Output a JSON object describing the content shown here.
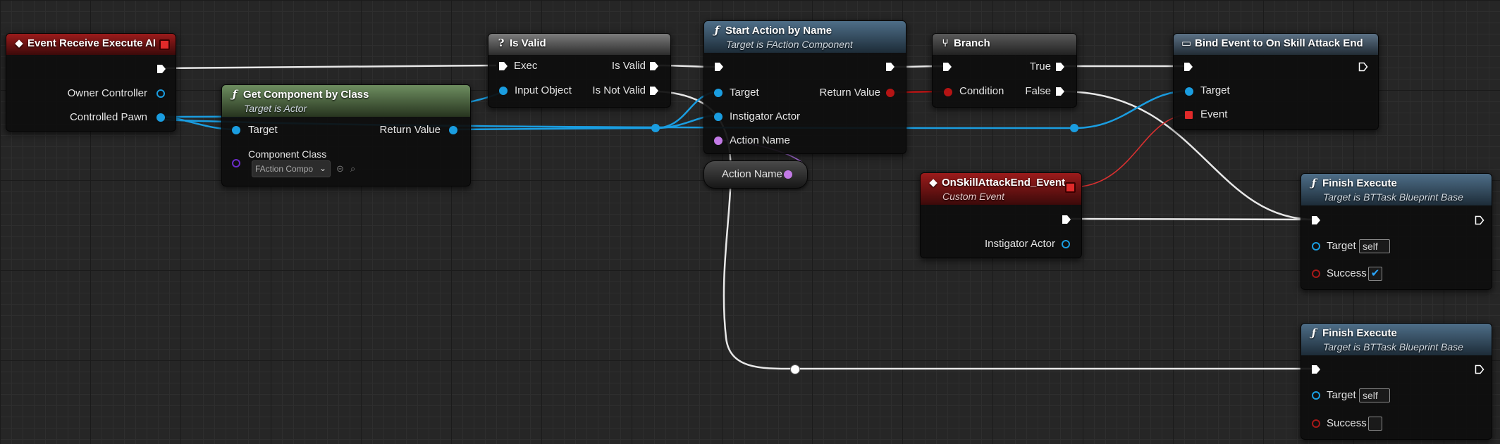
{
  "colors": {
    "exec": "#ffffff",
    "object": "#1a9de0",
    "name": "#c37ae6",
    "bool": "#b51414",
    "delegate": "#e02a2a"
  },
  "nodes": {
    "event_receive": {
      "title": "Event Receive Execute AI",
      "pins": {
        "owner": "Owner Controller",
        "pawn": "Controlled Pawn"
      }
    },
    "get_component": {
      "title": "Get Component by Class",
      "subtitle": "Target is Actor",
      "pins": {
        "target": "Target",
        "return": "Return Value",
        "class": "Component Class"
      },
      "class_value": "FAction Compo"
    },
    "is_valid": {
      "title": "Is Valid",
      "pins": {
        "exec": "Exec",
        "valid": "Is Valid",
        "input": "Input Object",
        "not_valid": "Is Not Valid"
      }
    },
    "start_action": {
      "title": "Start Action by Name",
      "subtitle": "Target is FAction Component",
      "pins": {
        "target": "Target",
        "return": "Return Value",
        "instigator": "Instigator Actor",
        "action_name": "Action Name"
      }
    },
    "action_name_var": {
      "label": "Action Name"
    },
    "branch": {
      "title": "Branch",
      "pins": {
        "condition": "Condition",
        "true": "True",
        "false": "False"
      }
    },
    "bind_event": {
      "title": "Bind Event to On Skill Attack End",
      "pins": {
        "target": "Target",
        "event": "Event"
      }
    },
    "custom_event": {
      "title": "OnSkillAttackEnd_Event",
      "subtitle": "Custom Event",
      "pins": {
        "instigator": "Instigator Actor"
      }
    },
    "finish_1": {
      "title": "Finish Execute",
      "subtitle": "Target is BTTask Blueprint Base",
      "pins": {
        "target": "Target",
        "success": "Success"
      },
      "target_value": "self",
      "success_checked": "✔"
    },
    "finish_2": {
      "title": "Finish Execute",
      "subtitle": "Target is BTTask Blueprint Base",
      "pins": {
        "target": "Target",
        "success": "Success"
      },
      "target_value": "self"
    }
  }
}
